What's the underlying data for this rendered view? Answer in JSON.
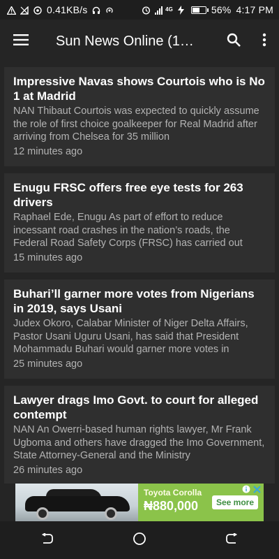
{
  "status_bar": {
    "network_speed": "0.41KB/s",
    "network_type": "4G",
    "battery": "56%",
    "battery_level": 0.56,
    "time": "4:17 PM"
  },
  "app_bar": {
    "title": "Sun News Online (1…",
    "menu_icon": "hamburger-icon",
    "search_icon": "search-icon",
    "more_icon": "more-vertical-icon"
  },
  "articles": [
    {
      "title": "Impressive Navas shows Courtois who is No 1 at Madrid",
      "excerpt": "NAN Thibaut Courtois was expected to quickly assume the role of first choice goalkeeper for Real Madrid after arriving from Chelsea for 35 million",
      "time": "12 minutes ago"
    },
    {
      "title": "Enugu FRSC offers free eye tests for 263 drivers",
      "excerpt": "Raphael Ede, Enugu As part of effort to reduce incessant road crashes in the nation’s roads, the Federal Road Safety Corps (FRSC) has carried out",
      "time": "15 minutes ago"
    },
    {
      "title": "Buhari’ll garner more votes from Nigerians in 2019, says Usani",
      "excerpt": "Judex Okoro, Calabar Minister of Niger Delta Affairs, Pastor Usani Uguru Usani, has said that President Mohammadu Buhari would garner more votes in",
      "time": "25 minutes ago"
    },
    {
      "title": "Lawyer drags Imo Govt. to court for alleged contempt",
      "excerpt": "NAN An Owerri-based human rights lawyer, Mr Frank Ugboma and others have dragged the Imo Government, State Attorney-General and the Ministry",
      "time": "26 minutes ago"
    }
  ],
  "ad": {
    "model": "Toyota Corolla",
    "price": "₦880,000",
    "cta": "See more",
    "brand_color": "#8bc34a"
  },
  "nav_bar": {
    "back_icon": "back-icon",
    "home_icon": "home-icon",
    "recents_icon": "recents-icon"
  }
}
